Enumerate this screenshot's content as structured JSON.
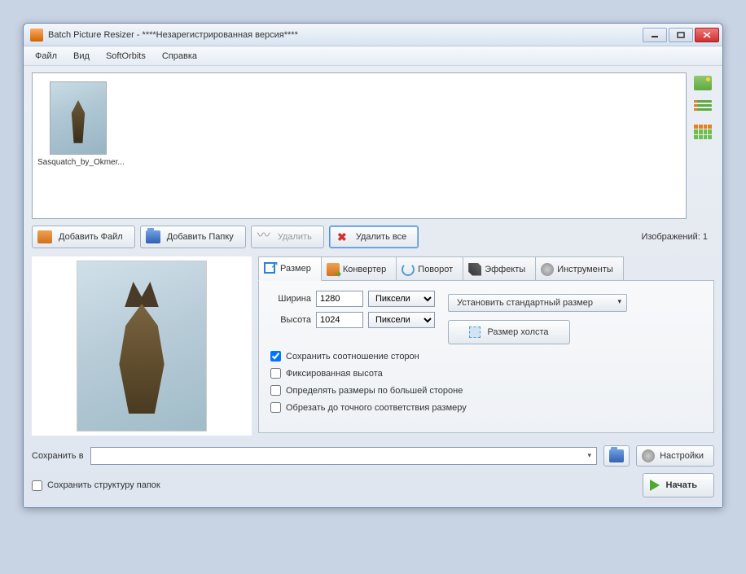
{
  "window": {
    "title": "Batch Picture Resizer - ****Незарегистрированная версия****"
  },
  "menu": {
    "file": "Файл",
    "view": "Вид",
    "softorbits": "SoftOrbits",
    "help": "Справка"
  },
  "thumb": {
    "name": "Sasquatch_by_Okmer..."
  },
  "actions": {
    "add_file": "Добавить Файл",
    "add_folder": "Добавить Папку",
    "delete": "Удалить",
    "delete_all": "Удалить все"
  },
  "count_label": "Изображений: 1",
  "tabs": {
    "size": "Размер",
    "converter": "Конвертер",
    "rotate": "Поворот",
    "effects": "Эффекты",
    "tools": "Инструменты"
  },
  "size": {
    "width_label": "Ширина",
    "height_label": "Высота",
    "width_value": "1280",
    "height_value": "1024",
    "unit": "Пиксели",
    "std_size": "Установить стандартный размер",
    "canvas": "Размер холста",
    "keep_ratio": "Сохранить соотношение сторон",
    "fixed_height": "Фиксированная высота",
    "by_larger": "Определять размеры по большей стороне",
    "crop_exact": "Обрезать до точного соответствия размеру"
  },
  "bottom": {
    "save_in": "Сохранить в",
    "settings": "Настройки",
    "keep_structure": "Сохранить структуру папок",
    "start": "Начать"
  }
}
